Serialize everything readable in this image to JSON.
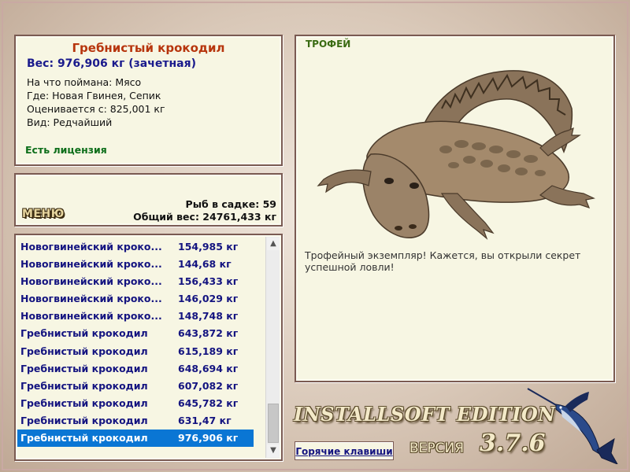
{
  "info": {
    "fish_name": "Гребнистый крокодил",
    "weight_line": "Вес: 976,906 кг (зачетная)",
    "bait_line": "На что поймана: Мясо",
    "location_line": "Где: Новая Гвинея, Сепик",
    "threshold_line": "Оценивается с: 825,001 кг",
    "rarity_line": "Вид: Редчайший",
    "license": "Есть лицензия"
  },
  "menu": {
    "button": "МЕНЮ",
    "fish_count": "Рыб в садке: 59",
    "total_weight": "Общий вес: 24761,433 кг"
  },
  "catch_list": [
    {
      "name": "Новогвинейский кроко...",
      "weight": "154,985 кг"
    },
    {
      "name": "Новогвинейский кроко...",
      "weight": "144,68 кг"
    },
    {
      "name": "Новогвинейский кроко...",
      "weight": "156,433 кг"
    },
    {
      "name": "Новогвинейский кроко...",
      "weight": "146,029 кг"
    },
    {
      "name": "Новогвинейский кроко...",
      "weight": "148,748 кг"
    },
    {
      "name": "Гребнистый крокодил",
      "weight": "643,872 кг"
    },
    {
      "name": "Гребнистый крокодил",
      "weight": "615,189 кг"
    },
    {
      "name": "Гребнистый крокодил",
      "weight": "648,694 кг"
    },
    {
      "name": "Гребнистый крокодил",
      "weight": "607,082 кг"
    },
    {
      "name": "Гребнистый крокодил",
      "weight": "645,782 кг"
    },
    {
      "name": "Гребнистый крокодил",
      "weight": "631,47 кг"
    },
    {
      "name": "Гребнистый крокодил",
      "weight": "976,906 кг"
    }
  ],
  "selected_index": 11,
  "trophy": {
    "label": "ТРОФЕЙ",
    "message": "Трофейный экземпляр! Кажется, вы открыли секрет успешной ловли!"
  },
  "branding": {
    "edition": "INSTALLSOFT EDITION",
    "version_label": "ВЕРСИЯ",
    "version_number": "3.7.6"
  },
  "hotkeys_label": "Горячие клавиши",
  "icons": {
    "scroll_up": "▲",
    "scroll_down": "▼"
  },
  "colors": {
    "fish_name": "#b7350d",
    "weight": "#1a1a8c",
    "license": "#0d6e1a",
    "selection": "#0a76d4"
  }
}
